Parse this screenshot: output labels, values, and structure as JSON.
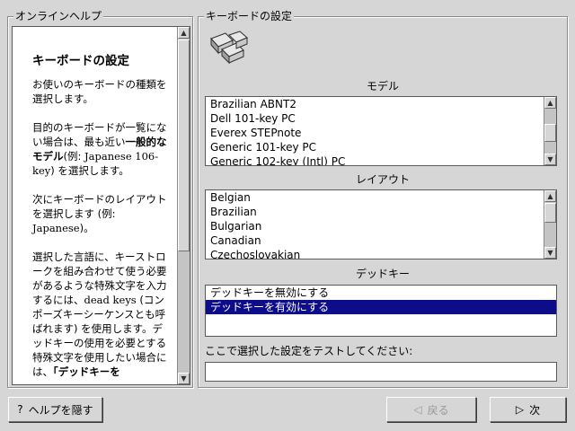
{
  "help": {
    "frame_title": "オンラインヘルプ",
    "title": "キーボードの設定",
    "p1": "お使いのキーボードの種類を選択します。",
    "p2_a": "目的のキーボードが一覧にない場合は、最も近い",
    "p2_bold": "一般的なモデル",
    "p2_b": "(例: ",
    "p2_example": "Japanese 106-key",
    "p2_c": ") を選択します。",
    "p3_a": "次にキーボードのレイアウトを選択します (例: ",
    "p3_example": "Japanese",
    "p3_b": ")。",
    "p4_a": "選択した言語に、キーストロークを組み合わせて使う必要があるような特殊文字を入力するには、",
    "p4_term": "dead keys",
    "p4_b": " (コンポーズキーシーケンスとも呼ばれます) を使用します。デッドキーの使用を必要とする特殊文字を使用したい場合には、",
    "p4_bold": "「デッドキーを"
  },
  "keyboard": {
    "frame_title": "キーボードの設定",
    "model_label": "モデル",
    "models": [
      "Brazilian ABNT2",
      "Dell 101-key PC",
      "Everex STEPnote",
      "Generic 101-key PC",
      "Generic 102-key (Intl) PC"
    ],
    "layout_label": "レイアウト",
    "layouts": [
      "Belgian",
      "Brazilian",
      "Bulgarian",
      "Canadian",
      "Czechoslovakian"
    ],
    "deadkey_label": "デッドキー",
    "deadkeys": [
      "デッドキーを無効にする",
      "デッドキーを有効にする"
    ],
    "deadkey_selected_index": 1,
    "test_label": "ここで選択した設定をテストしてください:",
    "test_value": ""
  },
  "buttons": {
    "hide_help": "ヘルプを隠す",
    "back": "戻る",
    "next": "次"
  },
  "colors": {
    "selection": "#0d0d8c",
    "background": "#d6d6d6"
  }
}
